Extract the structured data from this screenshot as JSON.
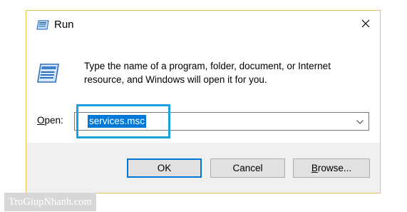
{
  "window": {
    "title": "Run",
    "title_icon": "run-icon",
    "close_icon": "close-icon"
  },
  "body": {
    "icon": "run-icon",
    "description": "Type the name of a program, folder, document, or Internet resource, and Windows will open it for you.",
    "open_label_mnemonic": "O",
    "open_label_rest": "pen:",
    "open_value": "services.msc",
    "dropdown_icon": "chevron-down-icon"
  },
  "buttons": {
    "ok": "OK",
    "cancel": "Cancel",
    "browse_mnemonic": "B",
    "browse_rest": "rowse..."
  },
  "watermark": "TroGiupNhanh.com",
  "colors": {
    "selection": "#0078d7",
    "highlight_box": "#1ba1e2",
    "footer_bg": "#f0f0f0",
    "dialog_border": "#e2c25a"
  }
}
